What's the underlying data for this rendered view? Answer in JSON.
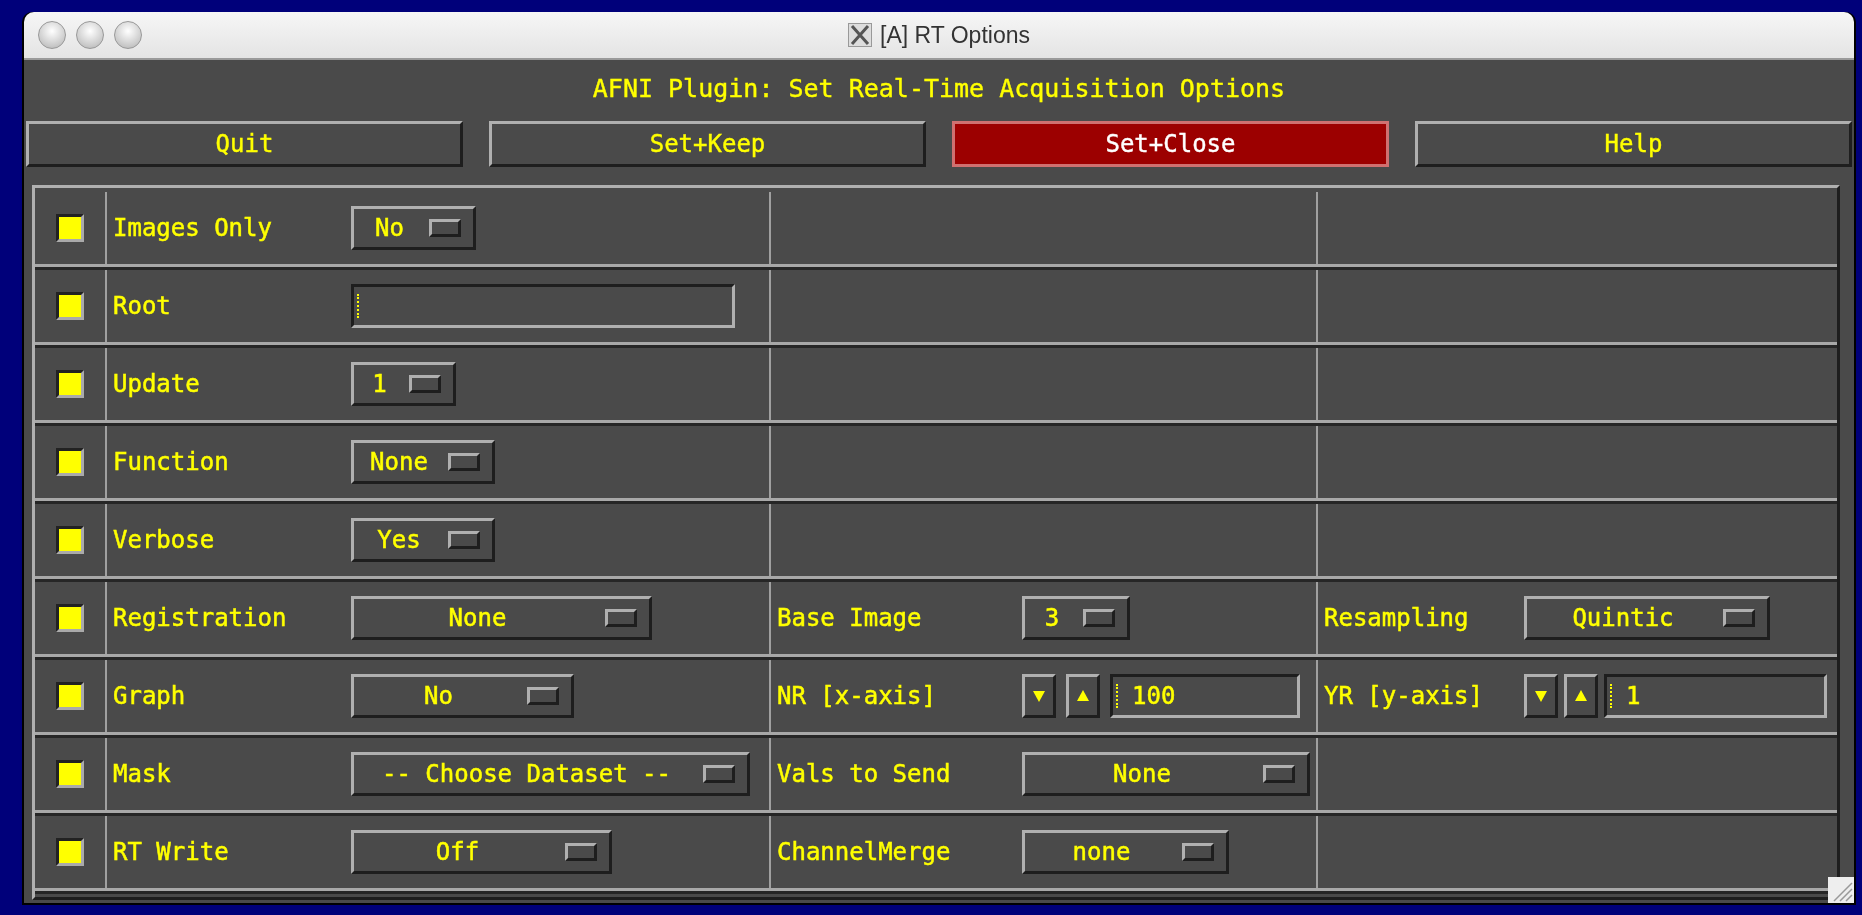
{
  "window": {
    "title": "[A] RT Options"
  },
  "header": "AFNI Plugin: Set Real-Time Acquisition Options",
  "buttons": [
    {
      "label": "Quit",
      "default": false
    },
    {
      "label": "Set+Keep",
      "default": false
    },
    {
      "label": "Set+Close",
      "default": true
    },
    {
      "label": "Help",
      "default": false
    }
  ],
  "rows": [
    {
      "checked": true,
      "cells": [
        {
          "label": "Images Only",
          "control": {
            "kind": "menu",
            "value": "No"
          }
        }
      ]
    },
    {
      "checked": true,
      "cells": [
        {
          "label": "Root",
          "control": {
            "kind": "text"
          }
        }
      ]
    },
    {
      "checked": true,
      "cells": [
        {
          "label": "Update",
          "control": {
            "kind": "menu",
            "value": "1"
          }
        }
      ]
    },
    {
      "checked": true,
      "cells": [
        {
          "label": "Function",
          "control": {
            "kind": "menu",
            "value": "None"
          }
        }
      ]
    },
    {
      "checked": true,
      "cells": [
        {
          "label": "Verbose",
          "control": {
            "kind": "menu",
            "value": "Yes"
          }
        }
      ]
    },
    {
      "checked": true,
      "cells": [
        {
          "label": "Registration",
          "control": {
            "kind": "menu",
            "value": "None"
          }
        },
        {
          "label": "Base Image",
          "control": {
            "kind": "menu",
            "value": "3"
          }
        },
        {
          "label": "Resampling",
          "control": {
            "kind": "menu",
            "value": "Quintic"
          }
        }
      ]
    },
    {
      "checked": true,
      "cells": [
        {
          "label": "Graph",
          "control": {
            "kind": "menu",
            "value": "No"
          }
        },
        {
          "label": "NR [x-axis]",
          "control": {
            "kind": "spinner",
            "value": "100"
          }
        },
        {
          "label": "YR [y-axis]",
          "control": {
            "kind": "spinner",
            "value": "1"
          }
        }
      ]
    },
    {
      "checked": true,
      "cells": [
        {
          "label": "Mask",
          "control": {
            "kind": "menu",
            "value": "-- Choose Dataset --"
          }
        },
        {
          "label": "Vals to Send",
          "control": {
            "kind": "menu",
            "value": "None"
          }
        }
      ]
    },
    {
      "checked": true,
      "cells": [
        {
          "label": "RT Write",
          "control": {
            "kind": "menu",
            "value": "Off"
          }
        },
        {
          "label": "ChannelMerge",
          "control": {
            "kind": "menu",
            "value": "none"
          }
        }
      ]
    }
  ]
}
